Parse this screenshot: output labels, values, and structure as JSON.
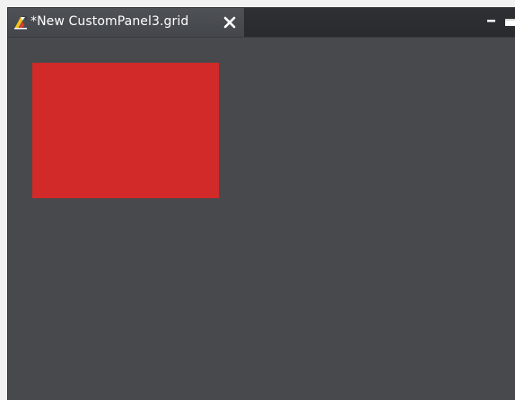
{
  "editor": {
    "tab_title": "*New CustomPanel3.grid",
    "tab_icon": "app-logo-icon",
    "close_icon": "close-icon",
    "minimize_icon": "minimize-icon",
    "maximize_icon": "maximize-icon"
  },
  "canvas": {
    "background_color": "#48494c",
    "element": {
      "type": "rectangle",
      "color": "#d12a29"
    }
  }
}
